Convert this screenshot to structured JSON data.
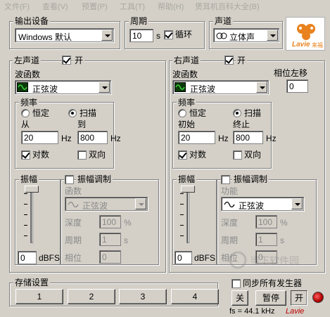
{
  "menu": [
    "文件(F)",
    "查看(V)",
    "预置(P)",
    "工具(T)",
    "帮助(H)",
    "煲耳机百科大全(B)"
  ],
  "output": {
    "label": "输出设备",
    "device": "Windows 默认"
  },
  "period": {
    "label": "周期",
    "value": "10",
    "unit": "s",
    "loop_label": "循环",
    "loop_checked": true
  },
  "channel_mode": {
    "label": "声道",
    "value": "立体声"
  },
  "logo": {
    "text": "Lavie",
    "sub": "来福"
  },
  "left": {
    "title": "左声道",
    "on_label": "开",
    "on": true,
    "waveform_label": "波函数",
    "waveform": "正弦波",
    "freq_label": "频率",
    "fixed_label": "恒定",
    "sweep_label": "扫描",
    "mode": "sweep",
    "from_label": "从",
    "to_label": "到",
    "from": "20",
    "to": "800",
    "hz": "Hz",
    "log_label": "对数",
    "log": true,
    "bidir_label": "双向",
    "bidir": false,
    "amp_label": "振幅",
    "amp_value": "0",
    "amp_unit": "dBFS",
    "mod_label": "振幅调制",
    "mod": false,
    "func_label": "函数",
    "func": "正弦波",
    "depth_label": "深度",
    "depth": "100",
    "depth_unit": "%",
    "period_label": "周期",
    "period": "1",
    "period_unit": "s",
    "phase_label": "相位",
    "phase": "0"
  },
  "right": {
    "title": "右声道",
    "on_label": "开",
    "on": true,
    "waveform_label": "波函数",
    "waveform": "正弦波",
    "phase_shift_label": "相位左移",
    "phase_shift": "0",
    "freq_label": "频率",
    "fixed_label": "恒定",
    "sweep_label": "扫描",
    "mode": "sweep",
    "from_label": "初始",
    "to_label": "终止",
    "from": "20",
    "to": "800",
    "hz": "Hz",
    "log_label": "对数",
    "log": true,
    "bidir_label": "双向",
    "bidir": false,
    "amp_label": "振幅",
    "amp_value": "0",
    "amp_unit": "dBFS",
    "mod_label": "振幅调制",
    "mod": false,
    "func_label": "功能",
    "func": "正弦波",
    "depth_label": "深度",
    "depth": "100",
    "depth_unit": "%",
    "period_label": "周期",
    "period": "1",
    "period_unit": "s",
    "phase_label": "相位",
    "phase": "0"
  },
  "storage": {
    "label": "存储设置",
    "slots": [
      "1",
      "2",
      "3",
      "4"
    ]
  },
  "controls": {
    "sync_label": "同步所有发生器",
    "off": "关",
    "pause": "暂停",
    "on": "开"
  },
  "status": {
    "fs": "fs = 44.1 kHz"
  },
  "watermark": {
    "text": "当下软件园",
    "brand": "Lavie"
  }
}
